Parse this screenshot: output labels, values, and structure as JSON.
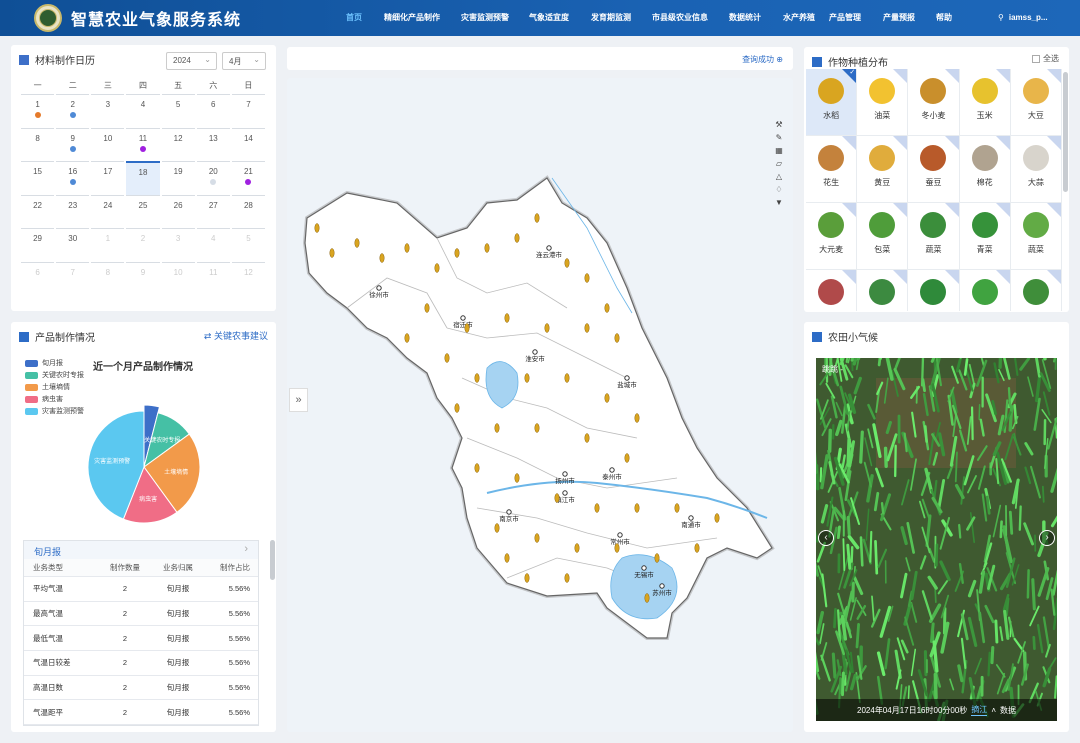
{
  "header": {
    "title": "智慧农业气象服务系统",
    "nav": [
      "首页",
      "精细化产品制作",
      "灾害监测预警",
      "气象适宜度",
      "发育期监测",
      "市县级农业信息",
      "数据统计",
      "水产养殖",
      "产品管理",
      "产量预报",
      "帮助"
    ],
    "active_nav": "首页",
    "user": "iamss_p..."
  },
  "calendar": {
    "title": "材料制作日历",
    "year": "2024",
    "month": "4月",
    "weekdays": [
      "一",
      "二",
      "三",
      "四",
      "五",
      "六",
      "日"
    ],
    "weeks": [
      [
        {
          "d": "1",
          "dot": "#e57a2b"
        },
        {
          "d": "2",
          "dot": "#4f8ad6"
        },
        {
          "d": "3"
        },
        {
          "d": "4"
        },
        {
          "d": "5"
        },
        {
          "d": "6"
        },
        {
          "d": "7"
        }
      ],
      [
        {
          "d": "8"
        },
        {
          "d": "9",
          "dot": "#4f8ad6"
        },
        {
          "d": "10"
        },
        {
          "d": "11",
          "dot": "#a020e0"
        },
        {
          "d": "12"
        },
        {
          "d": "13"
        },
        {
          "d": "14"
        }
      ],
      [
        {
          "d": "15"
        },
        {
          "d": "16",
          "dot": "#4f8ad6"
        },
        {
          "d": "17"
        },
        {
          "d": "18",
          "sel": true
        },
        {
          "d": "19"
        },
        {
          "d": "20",
          "dot": "#d6dde6"
        },
        {
          "d": "21",
          "dot": "#a020e0"
        }
      ],
      [
        {
          "d": "22"
        },
        {
          "d": "23"
        },
        {
          "d": "24"
        },
        {
          "d": "25"
        },
        {
          "d": "26"
        },
        {
          "d": "27"
        },
        {
          "d": "28"
        }
      ],
      [
        {
          "d": "29"
        },
        {
          "d": "30"
        },
        {
          "d": "1",
          "muted": true
        },
        {
          "d": "2",
          "muted": true
        },
        {
          "d": "3",
          "muted": true
        },
        {
          "d": "4",
          "muted": true
        },
        {
          "d": "5",
          "muted": true
        }
      ],
      [
        {
          "d": "6",
          "muted": true
        },
        {
          "d": "7",
          "muted": true
        },
        {
          "d": "8",
          "muted": true
        },
        {
          "d": "9",
          "muted": true
        },
        {
          "d": "10",
          "muted": true
        },
        {
          "d": "11",
          "muted": true
        },
        {
          "d": "12",
          "muted": true
        }
      ]
    ]
  },
  "product": {
    "title": "产品制作情况",
    "link": "关键农事建议",
    "legend": [
      {
        "name": "旬月报",
        "color": "#3d6fc8"
      },
      {
        "name": "关键农时专报",
        "color": "#45c0a5"
      },
      {
        "name": "土壤墒情",
        "color": "#f29a4a"
      },
      {
        "name": "病虫害",
        "color": "#f06d86"
      },
      {
        "name": "灾害监测预警",
        "color": "#5bc8f0"
      }
    ],
    "chart_title": "近一个月产品制作情况",
    "chart_data": {
      "type": "pie",
      "title": "近一个月产品制作情况",
      "categories": [
        "旬月报",
        "关键农时专报",
        "土壤墒情",
        "病虫害",
        "灾害监测预警"
      ],
      "values": [
        4,
        11,
        25,
        16,
        44
      ]
    },
    "table": {
      "tab": "旬月报",
      "headers": [
        "业务类型",
        "制作数量",
        "业务归属",
        "制作占比"
      ],
      "rows": [
        [
          "平均气温",
          "2",
          "旬月报",
          "5.56%"
        ],
        [
          "最高气温",
          "2",
          "旬月报",
          "5.56%"
        ],
        [
          "最低气温",
          "2",
          "旬月报",
          "5.56%"
        ],
        [
          "气温日较差",
          "2",
          "旬月报",
          "5.56%"
        ],
        [
          "高温日数",
          "2",
          "旬月报",
          "5.56%"
        ],
        [
          "气温距平",
          "2",
          "旬月报",
          "5.56%"
        ]
      ]
    }
  },
  "map": {
    "status": "查询成功",
    "cities": [
      "连云港市",
      "徐州市",
      "宿迁市",
      "淮安市",
      "盐城市",
      "扬州市",
      "泰州市",
      "镇江市",
      "南京市",
      "南通市",
      "常州市",
      "无锡市",
      "苏州市"
    ]
  },
  "crops": {
    "title": "作物种植分布",
    "select_all": "全选",
    "items": [
      {
        "name": "水稻",
        "color": "#d9a520",
        "sel": true
      },
      {
        "name": "油菜",
        "color": "#f2c230",
        "sel": false
      },
      {
        "name": "冬小麦",
        "color": "#c98f2c",
        "sel": false
      },
      {
        "name": "玉米",
        "color": "#e7c22e",
        "sel": false
      },
      {
        "name": "大豆",
        "color": "#e8b54a",
        "sel": false
      },
      {
        "name": "花生",
        "color": "#c4823c",
        "sel": false
      },
      {
        "name": "黄豆",
        "color": "#e0ac3c",
        "sel": false
      },
      {
        "name": "蚕豆",
        "color": "#b85a2a",
        "sel": false
      },
      {
        "name": "棉花",
        "color": "#b0a390",
        "sel": false
      },
      {
        "name": "大蒜",
        "color": "#d8d4cc",
        "sel": false
      },
      {
        "name": "大元麦",
        "color": "#5a9e3a",
        "sel": false
      },
      {
        "name": "包菜",
        "color": "#4f9d3a",
        "sel": false
      },
      {
        "name": "蔬菜",
        "color": "#3b8e3b",
        "sel": false
      },
      {
        "name": "青菜",
        "color": "#36923a",
        "sel": false
      },
      {
        "name": "蔬菜",
        "color": "#62ab45",
        "sel": false
      },
      {
        "name": "",
        "color": "#b04a4a",
        "sel": false
      },
      {
        "name": "",
        "color": "#3c8a40",
        "sel": false
      },
      {
        "name": "",
        "color": "#2f8a3a",
        "sel": false
      },
      {
        "name": "",
        "color": "#40a340",
        "sel": false
      },
      {
        "name": "",
        "color": "#3f8e3a",
        "sel": false
      }
    ]
  },
  "climate": {
    "title": "农田小气候",
    "station": "跳跳 -",
    "timestamp": "2024年04月17日16时00分00秒",
    "tab1": "摘江",
    "tab2": "数据"
  }
}
